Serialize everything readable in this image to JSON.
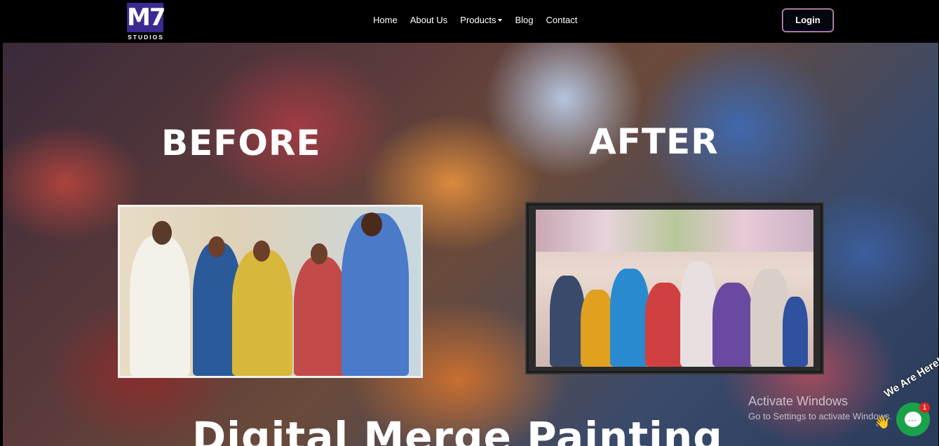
{
  "brand": {
    "logo_text": "M7",
    "logo_sub": "STUDIOS"
  },
  "nav": {
    "items": [
      {
        "label": "Home"
      },
      {
        "label": "About Us"
      },
      {
        "label": "Products",
        "has_dropdown": true
      },
      {
        "label": "Blog"
      },
      {
        "label": "Contact"
      }
    ],
    "login_label": "Login"
  },
  "hero": {
    "before_label": "BEFORE",
    "after_label": "AFTER",
    "headline": "Digital Merge Painting"
  },
  "watermark": {
    "title": "Activate Windows",
    "subtitle": "Go to Settings to activate Windows."
  },
  "chat": {
    "teaser": "We Are Here!",
    "badge_count": "1",
    "accent": "#19a24a"
  }
}
